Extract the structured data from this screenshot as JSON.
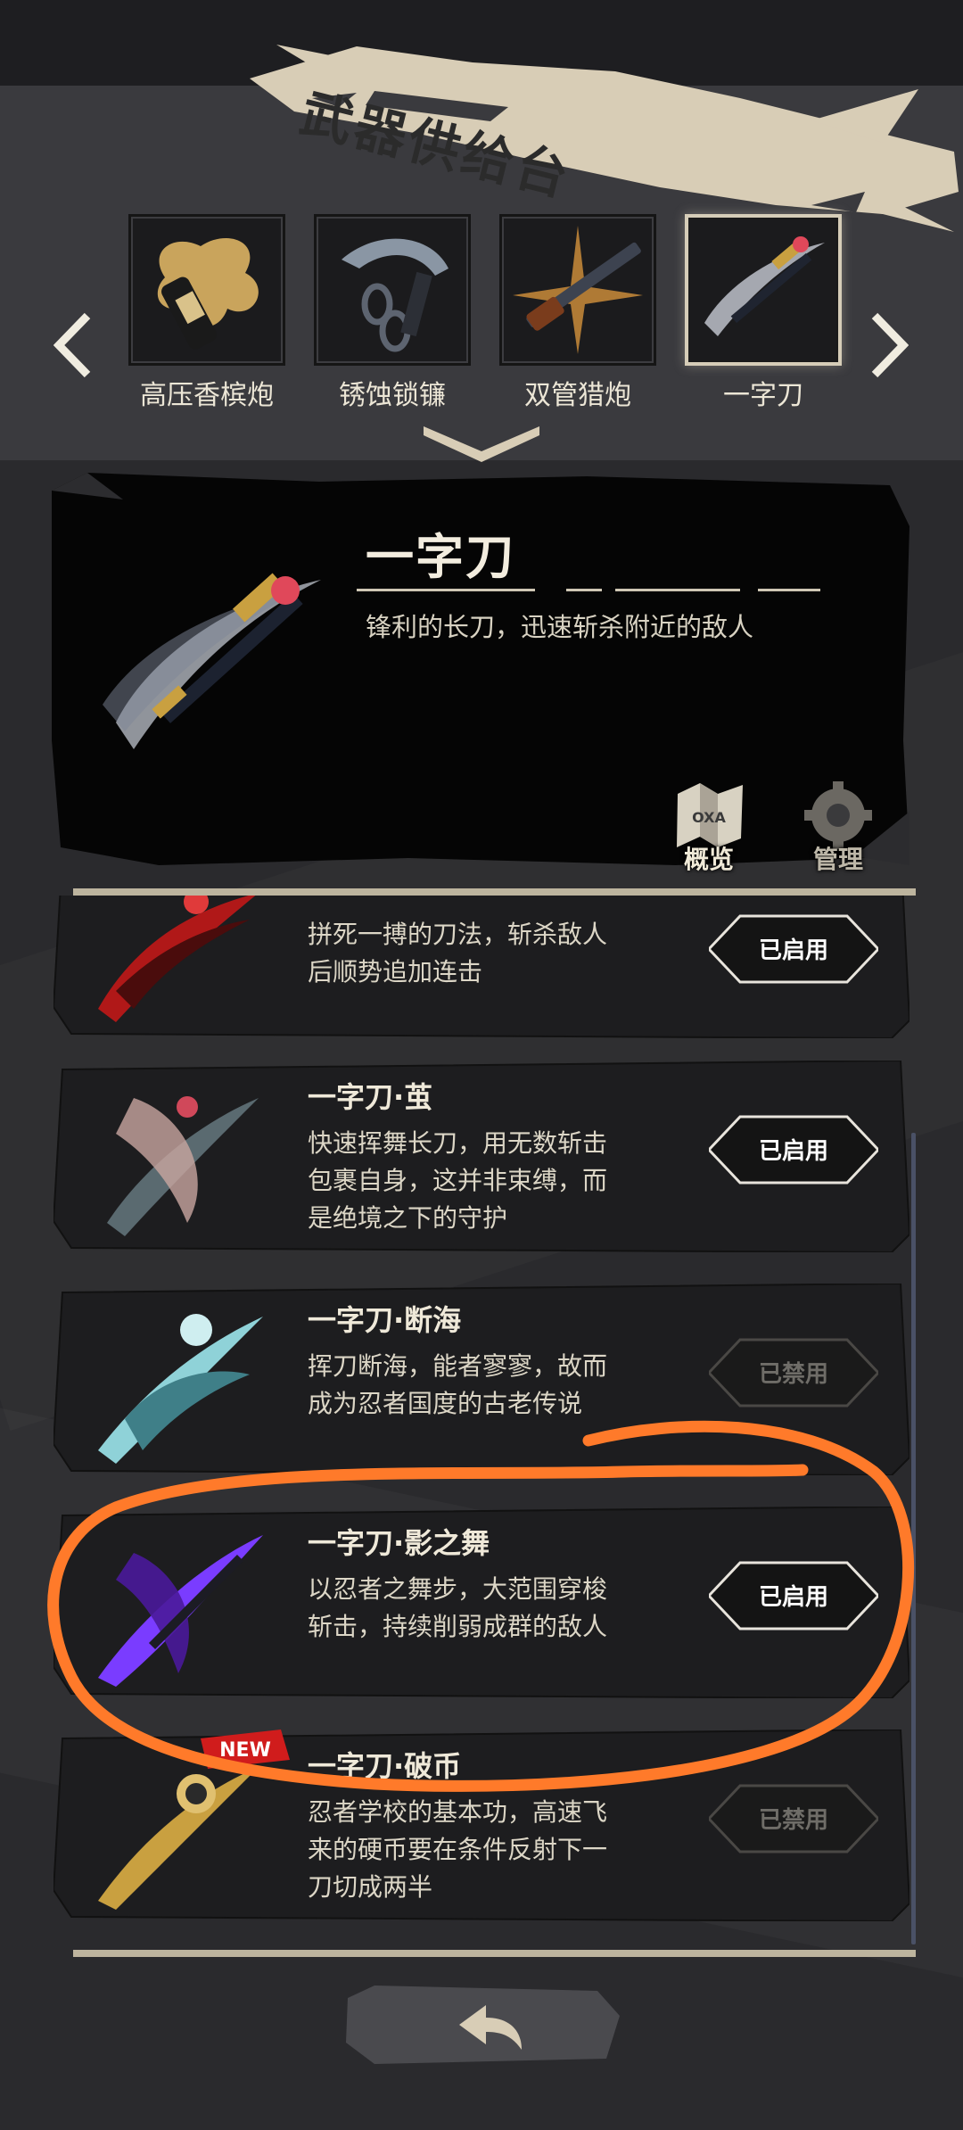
{
  "header": {
    "title": "武器供给台"
  },
  "selector": {
    "weapons": [
      {
        "label": "高压香槟炮",
        "icon": "champagne-cannon-icon"
      },
      {
        "label": "锈蚀锁镰",
        "icon": "chain-sickle-icon"
      },
      {
        "label": "双管猎炮",
        "icon": "double-barrel-gun-icon"
      },
      {
        "label": "一字刀",
        "icon": "katana-icon",
        "selected": true
      }
    ]
  },
  "detail": {
    "title": "一字刀",
    "description": "锋利的长刀，迅速斩杀附近的敌人",
    "overview_label": "概览",
    "manage_label": "管理"
  },
  "skills": [
    {
      "name": "",
      "desc_lines": [
        "拼死一搏的刀法，斩杀敌人",
        "后顺势追加连击"
      ],
      "status": "已启用",
      "enabled": true,
      "color": "#b01818"
    },
    {
      "name": "一字刀·茧",
      "desc_lines": [
        "快速挥舞长刀，用无数斩击",
        "包裹自身，这并非束缚，而",
        "是绝境之下的守护"
      ],
      "status": "已启用",
      "enabled": true,
      "color": "#c9a6a0"
    },
    {
      "name": "一字刀·断海",
      "desc_lines": [
        "挥刀断海，能者寥寥，故而",
        "成为忍者国度的古老传说"
      ],
      "status": "已禁用",
      "enabled": false,
      "color": "#8fd2d8"
    },
    {
      "name": "一字刀·影之舞",
      "desc_lines": [
        "以忍者之舞步，大范围穿梭",
        "斩击，持续削弱成群的敌人"
      ],
      "status": "已启用",
      "enabled": true,
      "color": "#7a3cff"
    },
    {
      "name": "一字刀·破币",
      "desc_lines": [
        "忍者学校的基本功，高速飞",
        "来的硬币要在条件反射下一",
        "刀切成两半"
      ],
      "status": "已禁用",
      "enabled": false,
      "color": "#c9a040",
      "badge": "NEW"
    }
  ],
  "colors": {
    "highlight": "#ff7a2a",
    "banner": "#d8cdb6",
    "rail": "#bdb49e"
  }
}
